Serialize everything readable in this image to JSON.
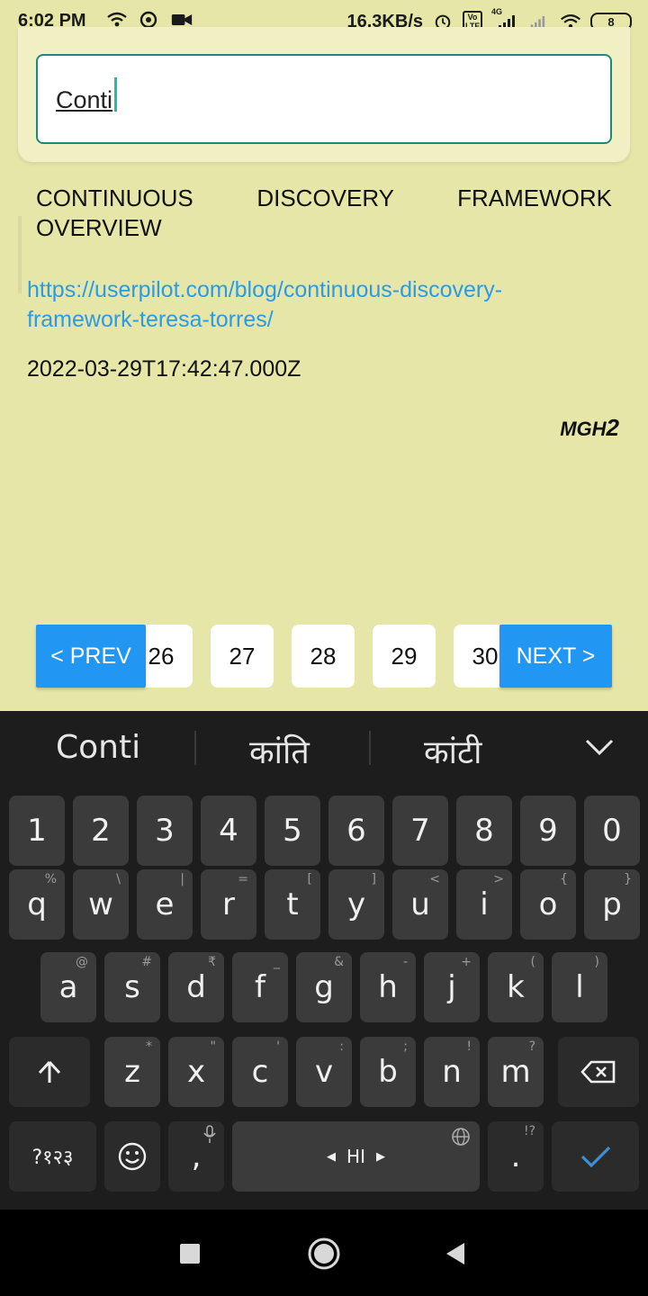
{
  "status_bar": {
    "time": "6:02 PM",
    "speed": "16.3KB/s",
    "battery": "8",
    "net_tag": "4G",
    "volte_tag": "Vo LTE"
  },
  "search": {
    "value": "Conti"
  },
  "result": {
    "title": "CONTINUOUS DISCOVERY FRAMEWORK OVERVIEW",
    "link": "https://userpilot.com/blog/continuous-discovery-framework-teresa-torres/",
    "date": "2022-03-29T17:42:47.000Z",
    "brand_prefix": "MGH",
    "brand_suffix": "2"
  },
  "pagination": {
    "prev_label": "< PREV",
    "next_label": "NEXT >",
    "pages": [
      "26",
      "27",
      "28",
      "29",
      "30"
    ]
  },
  "keyboard": {
    "suggestions": [
      "Conti",
      "कांति",
      "कांटी"
    ],
    "row_numbers": [
      "1",
      "2",
      "3",
      "4",
      "5",
      "6",
      "7",
      "8",
      "9",
      "0"
    ],
    "row1": [
      "q",
      "w",
      "e",
      "r",
      "t",
      "y",
      "u",
      "i",
      "o",
      "p"
    ],
    "row1_hints": [
      "%",
      "\\",
      "|",
      "=",
      "[",
      "]",
      "<",
      ">",
      "{",
      "}"
    ],
    "row2": [
      "a",
      "s",
      "d",
      "f",
      "g",
      "h",
      "j",
      "k",
      "l"
    ],
    "row2_hints": [
      "@",
      "#",
      "₹",
      "_",
      "&",
      "-",
      "+",
      "(",
      ")"
    ],
    "row3": [
      "z",
      "x",
      "c",
      "v",
      "b",
      "n",
      "m"
    ],
    "row3_hints": [
      "*",
      "\"",
      "'",
      ":",
      ";",
      "!",
      "?"
    ],
    "symbols_label": "?१२३",
    "comma_label": ",",
    "space_label": "HI",
    "period_label": ".",
    "period_hint": "!?"
  },
  "colors": {
    "background": "#e6e6a9",
    "accent_teal": "#1b8a78",
    "link_blue": "#2a9be8",
    "button_blue": "#2196f3",
    "keyboard_bg": "#1d1d1d",
    "enter_check": "#3d8fd4"
  }
}
